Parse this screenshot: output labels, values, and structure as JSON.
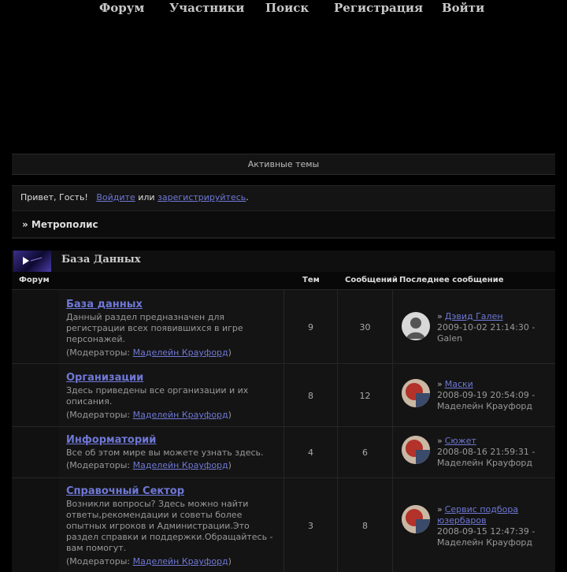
{
  "nav": {
    "forum": "Форум",
    "members": "Участники",
    "search": "Поиск",
    "register": "Регистрация",
    "login": "Войти"
  },
  "active_topics": "Активные темы",
  "greeting": {
    "hello": "Привет, Гость!",
    "login_link": "Войдите",
    "or": "или",
    "register_link": "зарегистрируйтесь",
    "end": "."
  },
  "breadcrumb": "» Метрополис",
  "category": {
    "title": "База Данных",
    "col_forum": "Форум",
    "col_topics": "Тем",
    "col_posts": "Сообщений",
    "col_last": "Последнее сообщение"
  },
  "forums": [
    {
      "title": "База данных",
      "desc": "Данный раздел предназначен для регистрации всех появившихся в игре персонажей.",
      "mod_prefix": "(Модераторы: ",
      "moderator": "Маделейн Крауфорд",
      "mod_suffix": ")",
      "topics": "9",
      "posts": "30",
      "last_topic": "Дэвид Гален",
      "last_date": "2009-10-02 21:14:30 -",
      "last_user": "Galen",
      "avatar": "default-avatar-icon"
    },
    {
      "title": "Организации",
      "desc": "Здесь приведены все организации и их описания.",
      "mod_prefix": "(Модераторы: ",
      "moderator": "Маделейн Крауфорд",
      "mod_suffix": ")",
      "topics": "8",
      "posts": "12",
      "last_topic": "Маски",
      "last_date": "2008-09-19 20:54:09 -",
      "last_user": "Маделейн Крауфорд",
      "avatar": "user-avatar"
    },
    {
      "title": "Информаторий",
      "desc": "Все об этом мире вы можете узнать здесь.",
      "mod_prefix": "(Модераторы: ",
      "moderator": "Маделейн Крауфорд",
      "mod_suffix": ")",
      "topics": "4",
      "posts": "6",
      "last_topic": "Сюжет",
      "last_date": "2008-08-16 21:59:31 -",
      "last_user": "Маделейн Крауфорд",
      "avatar": "user-avatar"
    },
    {
      "title": "Справочный Сектор",
      "desc": "Возникли вопросы? Здесь можно найти ответы,рекомендации и советы более опытных игроков и Администрации.Это раздел справки и поддержки.Обращайтесь - вам помогут.",
      "mod_prefix": "(Модераторы: ",
      "moderator": "Маделейн Крауфорд",
      "mod_suffix": ")",
      "topics": "3",
      "posts": "8",
      "last_topic": "Сервис подбора юзербаров",
      "last_date": "2008-09-15 12:47:39 -",
      "last_user": "Маделейн Крауфорд",
      "avatar": "user-avatar"
    }
  ]
}
